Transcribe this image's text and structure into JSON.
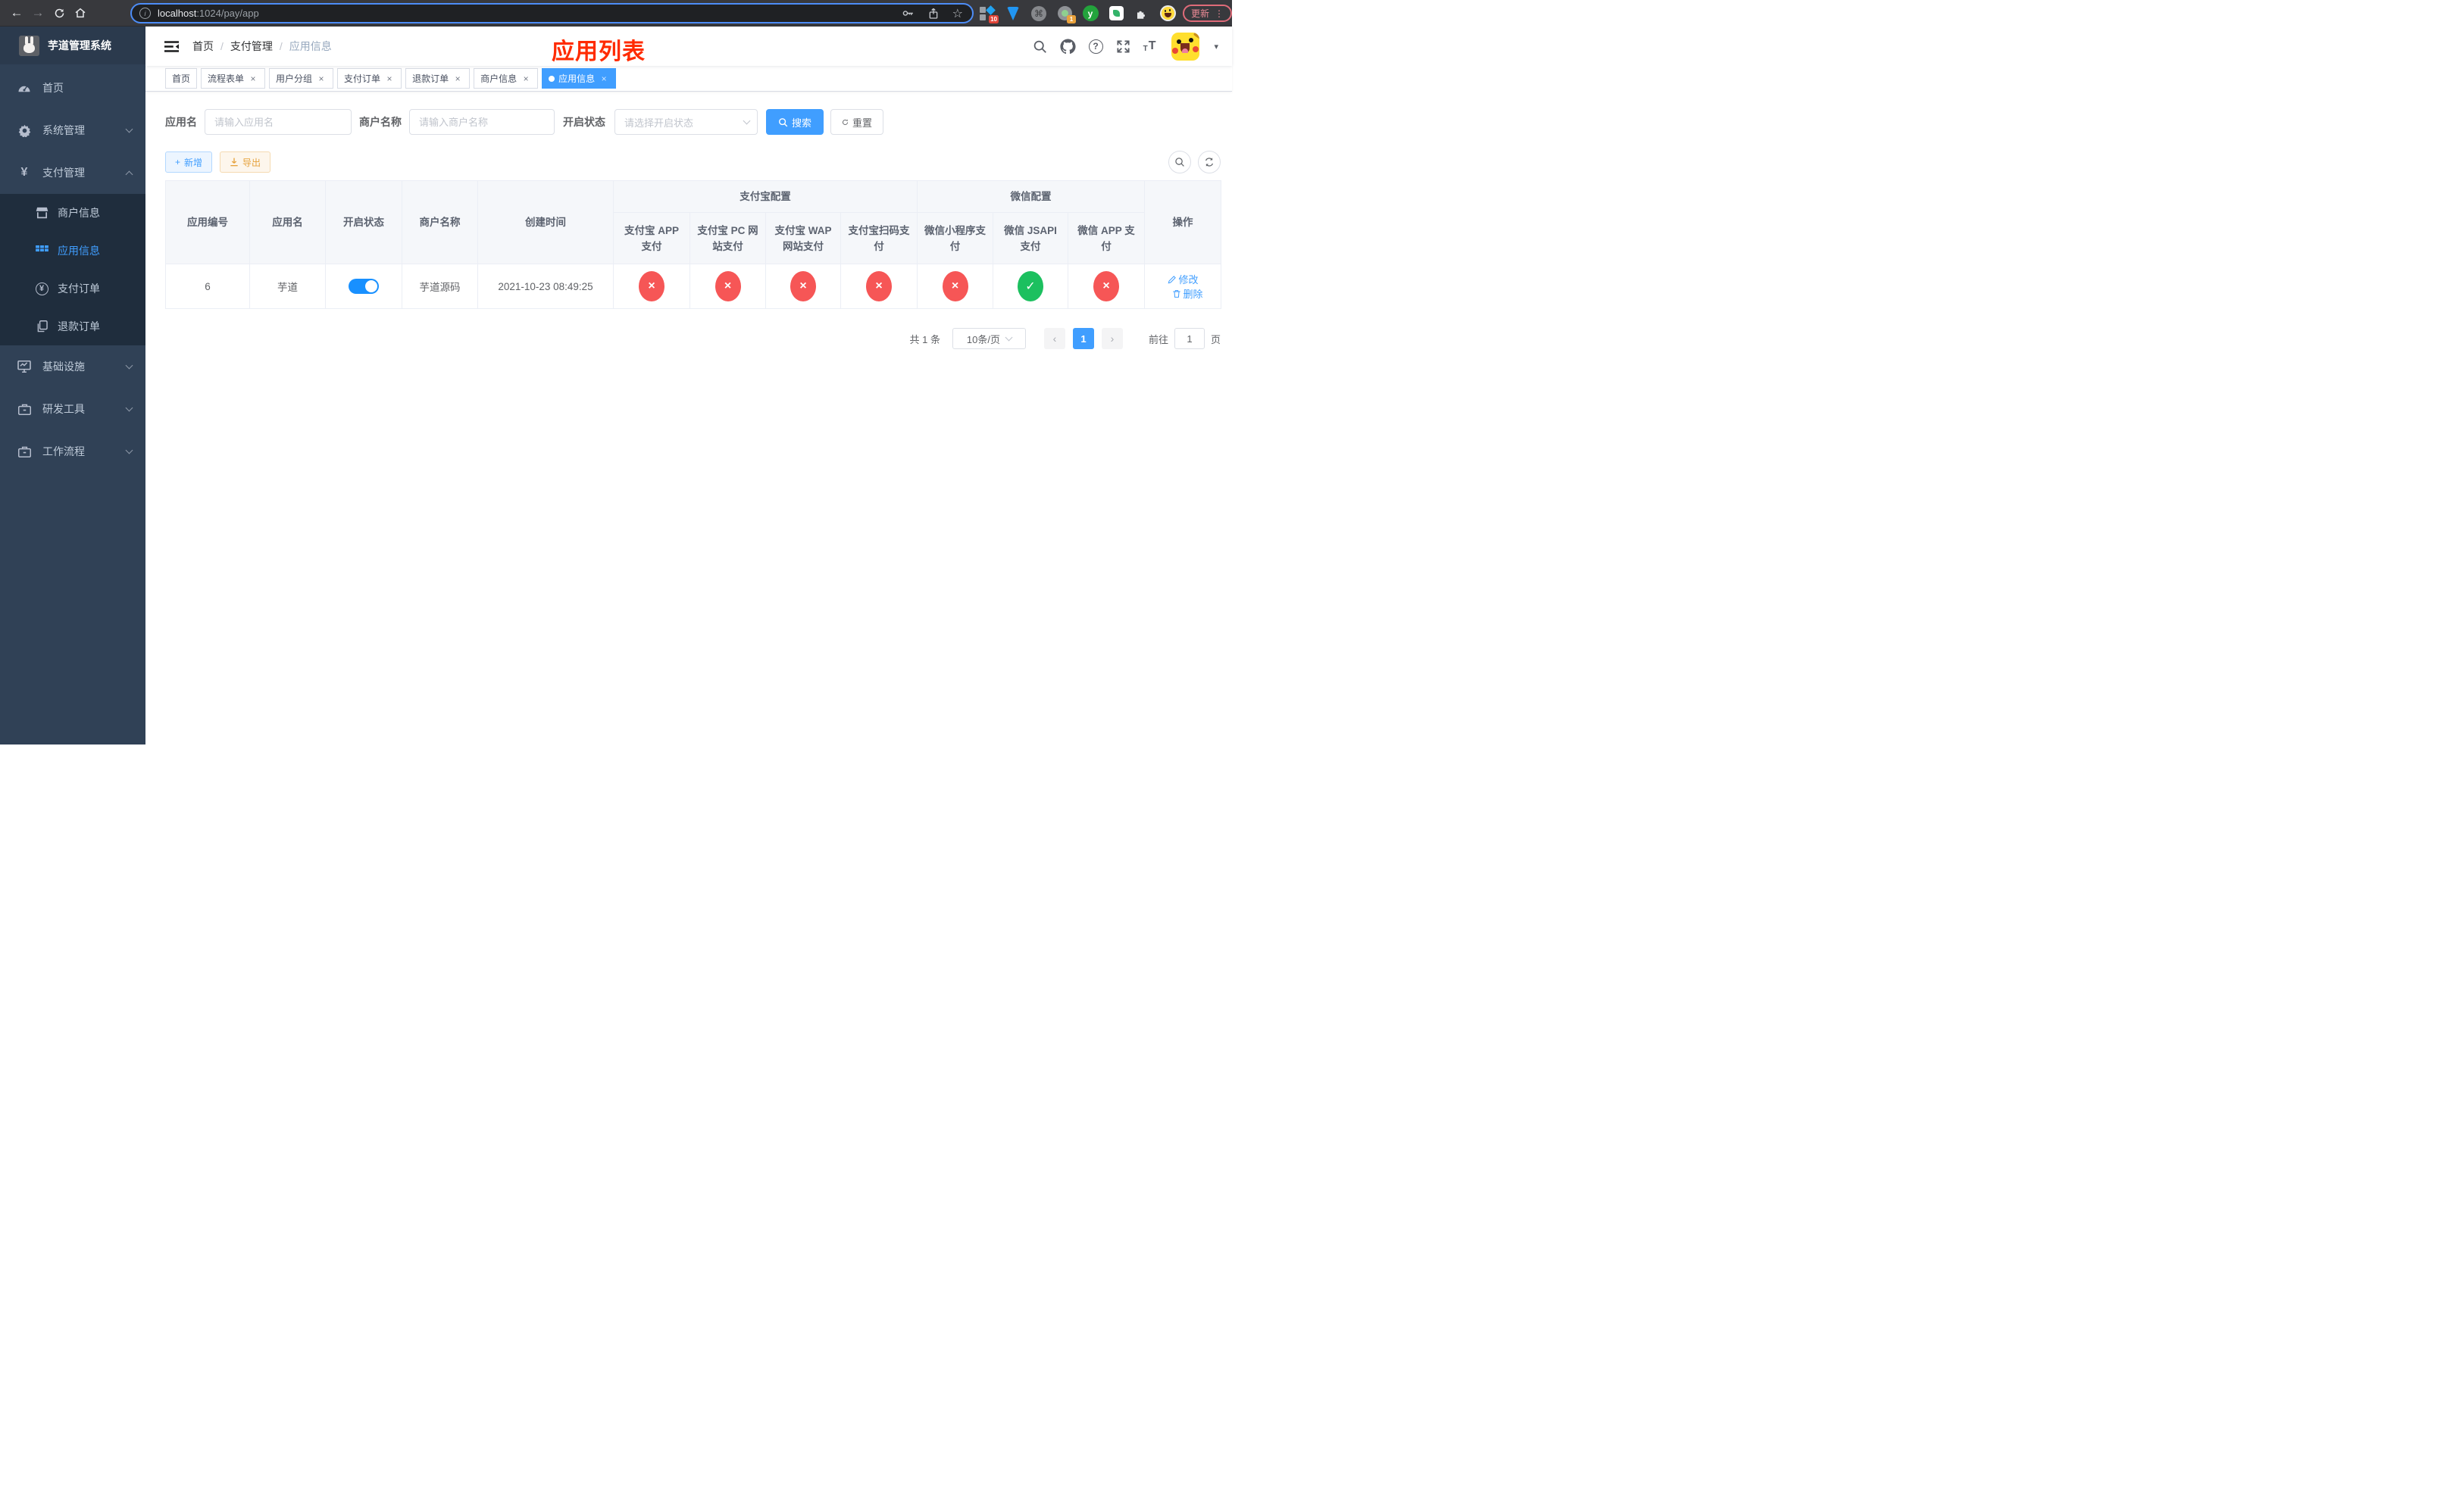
{
  "browser": {
    "url": {
      "host": "localhost",
      "path": ":1024/pay/app"
    },
    "update_label": "更新",
    "ext_badges": {
      "grid": "10",
      "ring": "1"
    },
    "ext_y_label": "y"
  },
  "sidebar": {
    "title": "芋道管理系统",
    "items": [
      {
        "label": "首页"
      },
      {
        "label": "系统管理"
      },
      {
        "label": "支付管理"
      },
      {
        "label": "基础设施"
      },
      {
        "label": "研发工具"
      },
      {
        "label": "工作流程"
      }
    ],
    "submenu": [
      {
        "label": "商户信息"
      },
      {
        "label": "应用信息"
      },
      {
        "label": "支付订单"
      },
      {
        "label": "退款订单"
      }
    ]
  },
  "header": {
    "breadcrumb": [
      "首页",
      "支付管理",
      "应用信息"
    ],
    "annotation": "应用列表"
  },
  "tabs": [
    {
      "label": "首页",
      "closable": false,
      "active": false
    },
    {
      "label": "流程表单",
      "closable": true,
      "active": false
    },
    {
      "label": "用户分组",
      "closable": true,
      "active": false
    },
    {
      "label": "支付订单",
      "closable": true,
      "active": false
    },
    {
      "label": "退款订单",
      "closable": true,
      "active": false
    },
    {
      "label": "商户信息",
      "closable": true,
      "active": false
    },
    {
      "label": "应用信息",
      "closable": true,
      "active": true
    }
  ],
  "filters": {
    "app_name_label": "应用名",
    "app_name_placeholder": "请输入应用名",
    "merchant_label": "商户名称",
    "merchant_placeholder": "请输入商户名称",
    "status_label": "开启状态",
    "status_placeholder": "请选择开启状态",
    "search_label": "搜索",
    "reset_label": "重置"
  },
  "toolbar": {
    "add_label": "新增",
    "export_label": "导出"
  },
  "table": {
    "headers": {
      "app_id": "应用编号",
      "app_name": "应用名",
      "status": "开启状态",
      "merchant": "商户名称",
      "created": "创建时间",
      "ops": "操作"
    },
    "groups": {
      "alipay": "支付宝配置",
      "wechat": "微信配置"
    },
    "sub_headers": [
      "支付宝 APP 支付",
      "支付宝 PC 网站支付",
      "支付宝 WAP 网站支付",
      "支付宝扫码支付",
      "微信小程序支付",
      "微信 JSAPI 支付",
      "微信 APP 支付"
    ],
    "row": {
      "app_id": "6",
      "app_name": "芋道",
      "status_on": true,
      "merchant": "芋道源码",
      "created": "2021-10-23 08:49:25",
      "pay_status": [
        "no",
        "no",
        "no",
        "no",
        "no",
        "yes",
        "no"
      ],
      "edit_label": "修改",
      "delete_label": "删除"
    }
  },
  "pagination": {
    "total": "共 1 条",
    "page_size": "10条/页",
    "current_page": "1",
    "goto_label": "前往",
    "goto_value": "1",
    "unit_label": "页"
  },
  "icons": {
    "back": "←",
    "forward": "→",
    "star": "☆",
    "info": "i",
    "command": "⌘",
    "dots": "⋮",
    "caret_down": "▾",
    "yuan": "¥",
    "check": "✓",
    "cross": "×",
    "close": "×",
    "prev": "‹",
    "next": "›",
    "question": "?",
    "plus": "+"
  },
  "colors": {
    "accent": "#409eff",
    "annotation": "#ff2b00",
    "status_no": "#f65656",
    "status_ok": "#1cc05f",
    "sidebar_bg": "#304156",
    "submenu_bg": "#1f2d3d"
  }
}
